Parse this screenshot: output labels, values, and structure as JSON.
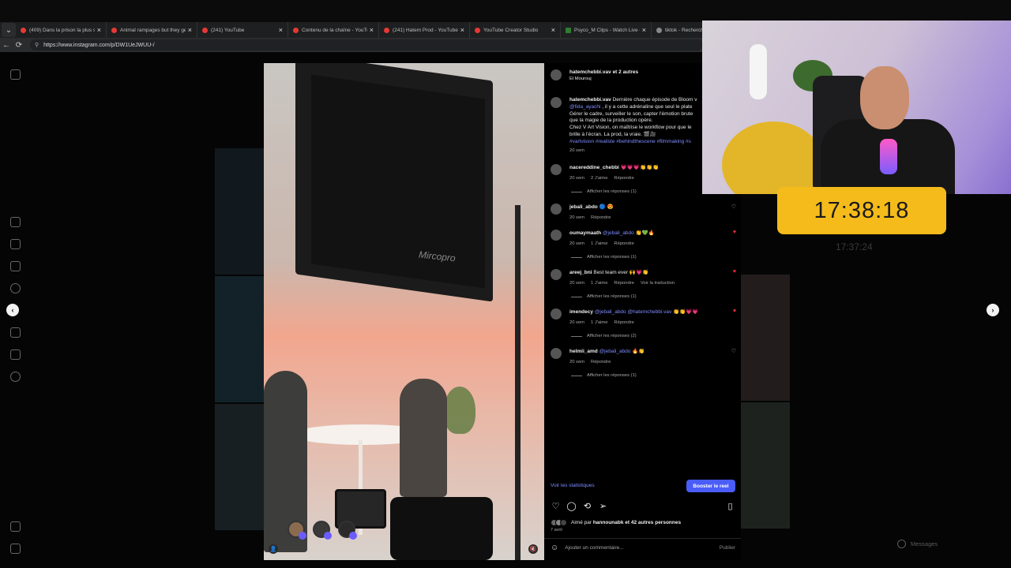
{
  "browser": {
    "tabs": [
      {
        "title": "(409) Dans la prison la plus susp",
        "favicon": "youtube"
      },
      {
        "title": "Animal rampages but they get i",
        "favicon": "youtube"
      },
      {
        "title": "(241) YouTube",
        "favicon": "youtube"
      },
      {
        "title": "Contenu de la chaîne - YouTube",
        "favicon": "youtube"
      },
      {
        "title": "(241) Hatem Prod - YouTube",
        "favicon": "youtube"
      },
      {
        "title": "YouTube Creator Studio",
        "favicon": "youtube"
      },
      {
        "title": "Psyco_M Clips - Watch Live on K",
        "favicon": "kick"
      },
      {
        "title": "tiktok - Recherche",
        "favicon": "search"
      }
    ],
    "url": "https://www.instagram.com/p/DW1UeJWUU-/"
  },
  "post": {
    "header": {
      "author": "hatemchebbi.vav",
      "coauthors": "et 2 autres",
      "location": "El Mourouj"
    },
    "caption": {
      "author": "hatemchebbi.vav",
      "text1": "Dernière chaque épisode de Bloom v",
      "mention": "@fida_ayachi",
      "text2": ", il y a cette adrénaline que seul le plate",
      "text3": "Gérer le cadre, surveiller le son, capter l'émotion brute",
      "text4": "que la magie de la production opère.",
      "text5": "Chez V Art Vision, on maîtrise le workflow pour que le",
      "text6": "brille à l'écran. La prod, la vraie. 🎬🎥",
      "hashtags": "#vartvision #realiste #behindthescene #filmmaking #s",
      "age": "20 sem"
    },
    "comments": [
      {
        "user": "nacereddine_chebbi",
        "mention": "",
        "text": "💗💗💗👏👏👏",
        "age": "20 sem",
        "likes": "2 J'aime",
        "reply": "Répondre",
        "translate": "",
        "liked": false,
        "show_heart": false,
        "replies": "Afficher les réponses (1)"
      },
      {
        "user": "jebali_abdo",
        "mention": "",
        "text": "🔵 😍",
        "age": "20 sem",
        "likes": "",
        "reply": "Répondre",
        "translate": "",
        "liked": false,
        "show_heart": true,
        "replies": ""
      },
      {
        "user": "oumaymaath",
        "mention": "@jebali_abdo",
        "text": "👏💚🔥",
        "age": "20 sem",
        "likes": "1 J'aime",
        "reply": "Répondre",
        "translate": "",
        "liked": true,
        "show_heart": true,
        "replies": "Afficher les réponses (1)"
      },
      {
        "user": "areej_bni",
        "mention": "",
        "text": "Best team ever 🙌💗👏",
        "age": "20 sem",
        "likes": "1 J'aime",
        "reply": "Répondre",
        "translate": "Voir la traduction",
        "liked": true,
        "show_heart": true,
        "replies": "Afficher les réponses (1)"
      },
      {
        "user": "imendecy",
        "mention": "@jebali_abdo @hatemchebbi.vav",
        "text": "👏👏💗💗",
        "age": "20 sem",
        "likes": "1 J'aime",
        "reply": "Répondre",
        "translate": "",
        "liked": true,
        "show_heart": true,
        "replies": "Afficher les réponses (2)"
      },
      {
        "user": "helmii_amd",
        "mention": "@jebali_abdo",
        "text": "🔥👏",
        "age": "20 sem",
        "likes": "",
        "reply": "Répondre",
        "translate": "",
        "liked": false,
        "show_heart": true,
        "replies": "Afficher les réponses (1)"
      }
    ],
    "stats_link": "Voir les statistiques",
    "boost_label": "Booster le reel",
    "liked_by_prefix": "Aimé par",
    "liked_by_user": "hannounabk",
    "liked_by_suffix": "et 42 autres personnes",
    "date": "7 avril",
    "add_comment_placeholder": "Ajouter un commentaire...",
    "publish_label": "Publier",
    "media_brand": "Mircopro"
  },
  "overlay": {
    "clock": "17:38:18",
    "ghost_clock": "17:37:24",
    "messages_label": "Messages"
  },
  "colors": {
    "accent": "#4a5df9",
    "link": "#7f8cff",
    "heart_red": "#ff3040",
    "clock_bg": "#f4bb1b"
  }
}
